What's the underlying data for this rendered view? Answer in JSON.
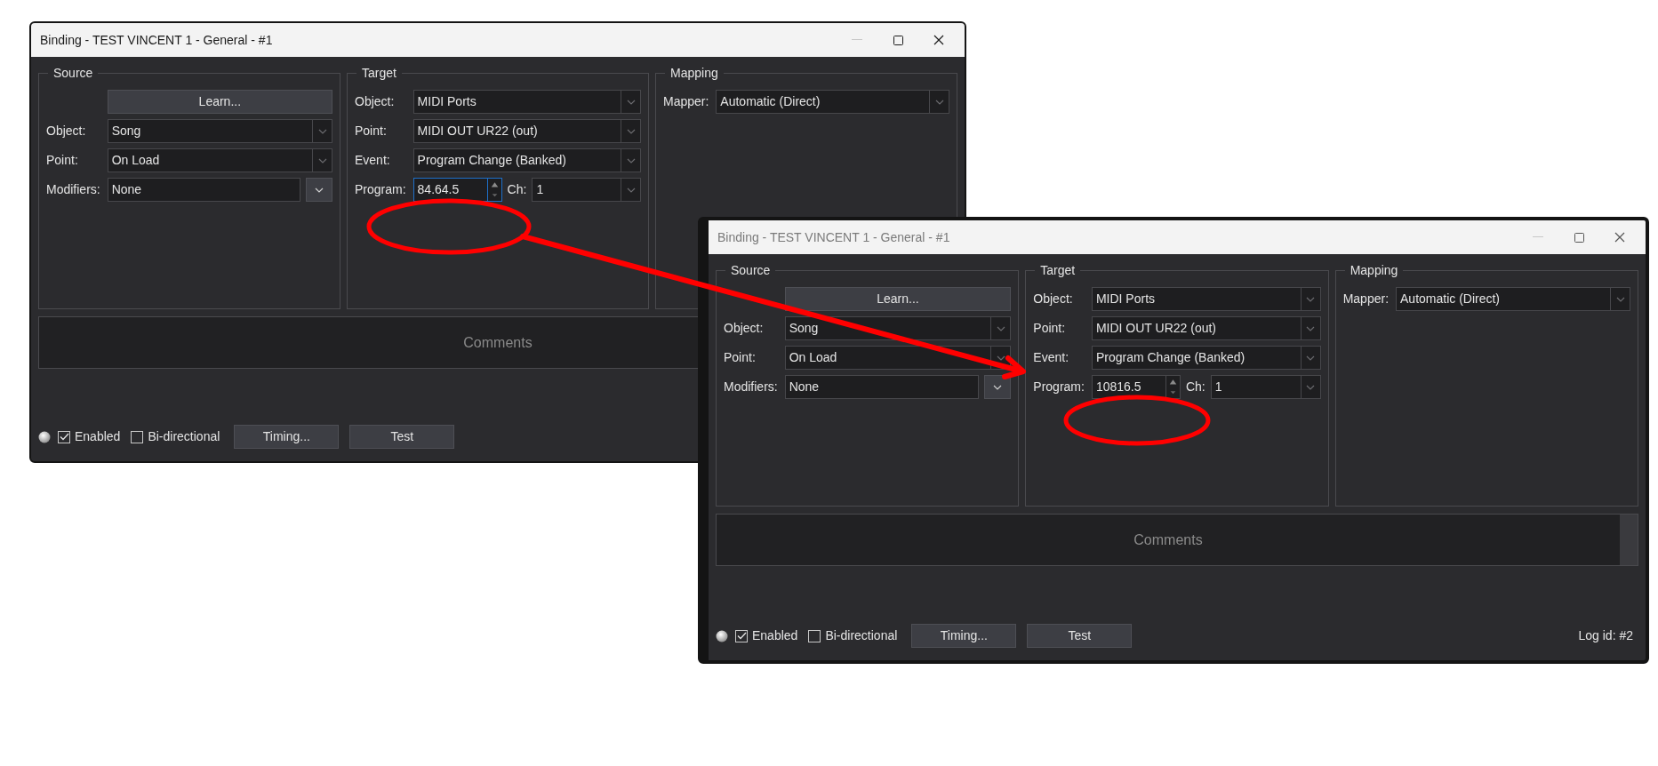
{
  "windows": [
    {
      "title": "Binding - TEST VINCENT 1 - General - #1",
      "active": true,
      "groups": [
        {
          "title": "Source",
          "rows": [
            {
              "kind": "button",
              "text": "Learn..."
            },
            {
              "kind": "combo",
              "label": "Object:",
              "value": "Song"
            },
            {
              "kind": "combo",
              "label": "Point:",
              "value": "On Load"
            },
            {
              "kind": "menu_field",
              "label": "Modifiers:",
              "value": "None"
            }
          ]
        },
        {
          "title": "Target",
          "rows": [
            {
              "kind": "combo",
              "label": "Object:",
              "value": "MIDI Ports"
            },
            {
              "kind": "combo",
              "label": "Point:",
              "value": "MIDI OUT UR22 (out)"
            },
            {
              "kind": "combo",
              "label": "Event:",
              "value": "Program Change (Banked)"
            },
            {
              "kind": "spin",
              "label": "Program:",
              "value": "84.64.5",
              "focused": true,
              "ch_label": "Ch:",
              "ch_value": "1"
            }
          ]
        },
        {
          "title": "Mapping",
          "rows": [
            {
              "kind": "combo",
              "label": "Mapper:",
              "value": "Automatic (Direct)"
            }
          ]
        }
      ],
      "comments": {
        "placeholder": "Comments"
      },
      "footer": {
        "enabled": {
          "label": "Enabled",
          "checked": true
        },
        "bidirectional": {
          "label": "Bi-directional",
          "checked": false
        },
        "buttons": [
          "Timing...",
          "Test"
        ]
      }
    },
    {
      "title": "Binding - TEST VINCENT 1 - General - #1",
      "active": false,
      "groups": [
        {
          "title": "Source",
          "rows": [
            {
              "kind": "button",
              "text": "Learn..."
            },
            {
              "kind": "combo",
              "label": "Object:",
              "value": "Song"
            },
            {
              "kind": "combo",
              "label": "Point:",
              "value": "On Load"
            },
            {
              "kind": "menu_field",
              "label": "Modifiers:",
              "value": "None"
            }
          ]
        },
        {
          "title": "Target",
          "rows": [
            {
              "kind": "combo",
              "label": "Object:",
              "value": "MIDI Ports"
            },
            {
              "kind": "combo",
              "label": "Point:",
              "value": "MIDI OUT UR22 (out)"
            },
            {
              "kind": "combo",
              "label": "Event:",
              "value": "Program Change (Banked)"
            },
            {
              "kind": "spin",
              "label": "Program:",
              "value": "10816.5",
              "focused": false,
              "ch_label": "Ch:",
              "ch_value": "1"
            }
          ]
        },
        {
          "title": "Mapping",
          "rows": [
            {
              "kind": "combo",
              "label": "Mapper:",
              "value": "Automatic (Direct)"
            }
          ]
        }
      ],
      "comments": {
        "placeholder": "Comments"
      },
      "footer": {
        "enabled": {
          "label": "Enabled",
          "checked": true
        },
        "bidirectional": {
          "label": "Bi-directional",
          "checked": false
        },
        "buttons": [
          "Timing...",
          "Test"
        ],
        "log_id": "Log id: #2"
      }
    }
  ]
}
